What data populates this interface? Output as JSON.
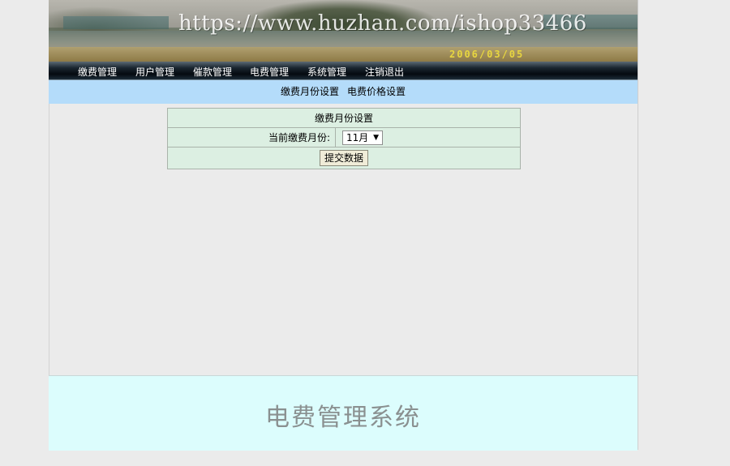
{
  "banner": {
    "watermark": "https://www.huzhan.com/ishop33466",
    "date_stamp": "2006/03/05"
  },
  "nav": {
    "items": [
      {
        "label": "缴费管理"
      },
      {
        "label": "用户管理"
      },
      {
        "label": "催款管理"
      },
      {
        "label": "电费管理"
      },
      {
        "label": "系统管理"
      },
      {
        "label": "注销退出"
      }
    ]
  },
  "subnav": {
    "links": [
      {
        "label": "缴费月份设置"
      },
      {
        "label": "电费价格设置"
      }
    ]
  },
  "form": {
    "title": "缴费月份设置",
    "month_label": "当前缴费月份:",
    "month_value": "11月",
    "submit_label": "提交数据"
  },
  "footer": {
    "system_name": "电费管理系统"
  },
  "colors": {
    "subnav_bg": "#b4dcfa",
    "form_bg": "#dcefe2",
    "footer_bg": "#dcfdfd",
    "nav_bg": "#0a1018"
  },
  "icons": {
    "select_arrow": "dropdown-arrow-icon"
  }
}
